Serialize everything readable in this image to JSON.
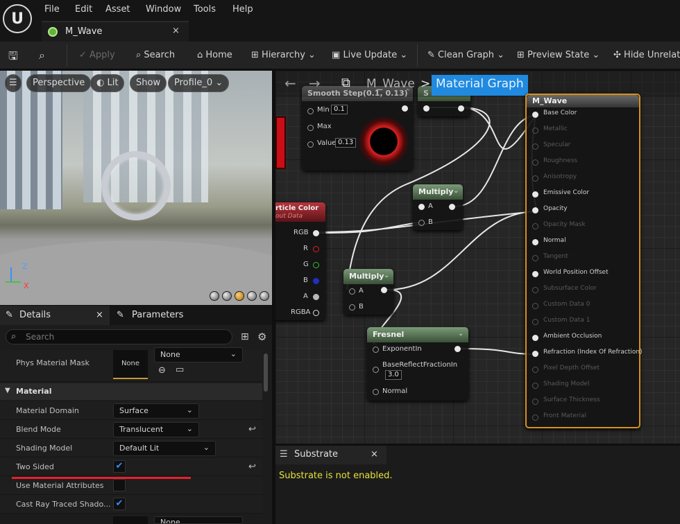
{
  "menu": [
    "File",
    "Edit",
    "Asset",
    "Window",
    "Tools",
    "Help"
  ],
  "doc_tab": {
    "label": "M_Wave",
    "close": "×"
  },
  "toolbar": {
    "apply": "Apply",
    "search": "Search",
    "home": "Home",
    "hierarchy": "Hierarchy",
    "live_update": "Live Update",
    "clean_graph": "Clean Graph",
    "preview_state": "Preview State",
    "hide_unrelated": "Hide Unrelate"
  },
  "viewport": {
    "perspective": "Perspective",
    "lit": "Lit",
    "show": "Show",
    "profile": "Profile_0",
    "axis_z": "Z",
    "axis_x": "X"
  },
  "details": {
    "tab_details": "Details",
    "tab_close": "×",
    "tab_parameters": "Parameters",
    "search_placeholder": "Search",
    "phys_label": "Phys Material Mask",
    "phys_thumb": "None",
    "phys_dd": "None",
    "section": "Material",
    "rows": [
      {
        "label": "Material Domain",
        "value": "Surface"
      },
      {
        "label": "Blend Mode",
        "value": "Translucent"
      },
      {
        "label": "Shading Model",
        "value": "Default Lit"
      },
      {
        "label": "Two Sided",
        "value": "✔"
      },
      {
        "label": "Use Material Attributes",
        "value": ""
      },
      {
        "label": "Cast Ray Traced Shado...",
        "value": "✔"
      }
    ],
    "bottom_dd": "None"
  },
  "graph": {
    "back": "←",
    "forward": "→",
    "breadcrumb_asset": "M_Wave",
    "breadcrumb_sep": ">",
    "breadcrumb_current": "Material Graph",
    "smoothstep": {
      "title": "Smooth Step(0.1, 0.13)",
      "min_label": "Min",
      "min": "0.1",
      "max_label": "Max",
      "value_label": "Value",
      "value": "0.13"
    },
    "s_node_title": "S",
    "multiply1": {
      "title": "Multiply",
      "a": "A",
      "b": "B"
    },
    "multiply2": {
      "title": "Multiply",
      "a": "A",
      "b": "B"
    },
    "particle": {
      "title": "rticle Color",
      "subtitle": "out Data",
      "pins": [
        "RGB",
        "R",
        "G",
        "B",
        "A",
        "RGBA"
      ]
    },
    "fresnel": {
      "title": "Fresnel",
      "p1": "ExponentIn",
      "p2": "BaseReflectFractionIn",
      "p2val": "3.0",
      "p3": "Normal"
    },
    "result": {
      "title": "M_Wave",
      "pins": [
        {
          "label": "Base Color",
          "active": true
        },
        {
          "label": "Metallic",
          "active": false
        },
        {
          "label": "Specular",
          "active": false
        },
        {
          "label": "Roughness",
          "active": false
        },
        {
          "label": "Anisotropy",
          "active": false
        },
        {
          "label": "Emissive Color",
          "active": true
        },
        {
          "label": "Opacity",
          "active": true
        },
        {
          "label": "Opacity Mask",
          "active": false
        },
        {
          "label": "Normal",
          "active": true
        },
        {
          "label": "Tangent",
          "active": false
        },
        {
          "label": "World Position Offset",
          "active": true
        },
        {
          "label": "Subsurface Color",
          "active": false
        },
        {
          "label": "Custom Data 0",
          "active": false
        },
        {
          "label": "Custom Data 1",
          "active": false
        },
        {
          "label": "Ambient Occlusion",
          "active": true
        },
        {
          "label": "Refraction (Index Of Refraction)",
          "active": true
        },
        {
          "label": "Pixel Depth Offset",
          "active": false
        },
        {
          "label": "Shading Model",
          "active": false
        },
        {
          "label": "Surface Thickness",
          "active": false
        },
        {
          "label": "Front Material",
          "active": false
        }
      ]
    }
  },
  "substrate": {
    "tab": "Substrate",
    "close": "×",
    "message": "Substrate is not enabled."
  },
  "colors": {
    "accent": "#1f8ae0",
    "annotation": "#e8202a",
    "warning": "#e6e23a"
  }
}
